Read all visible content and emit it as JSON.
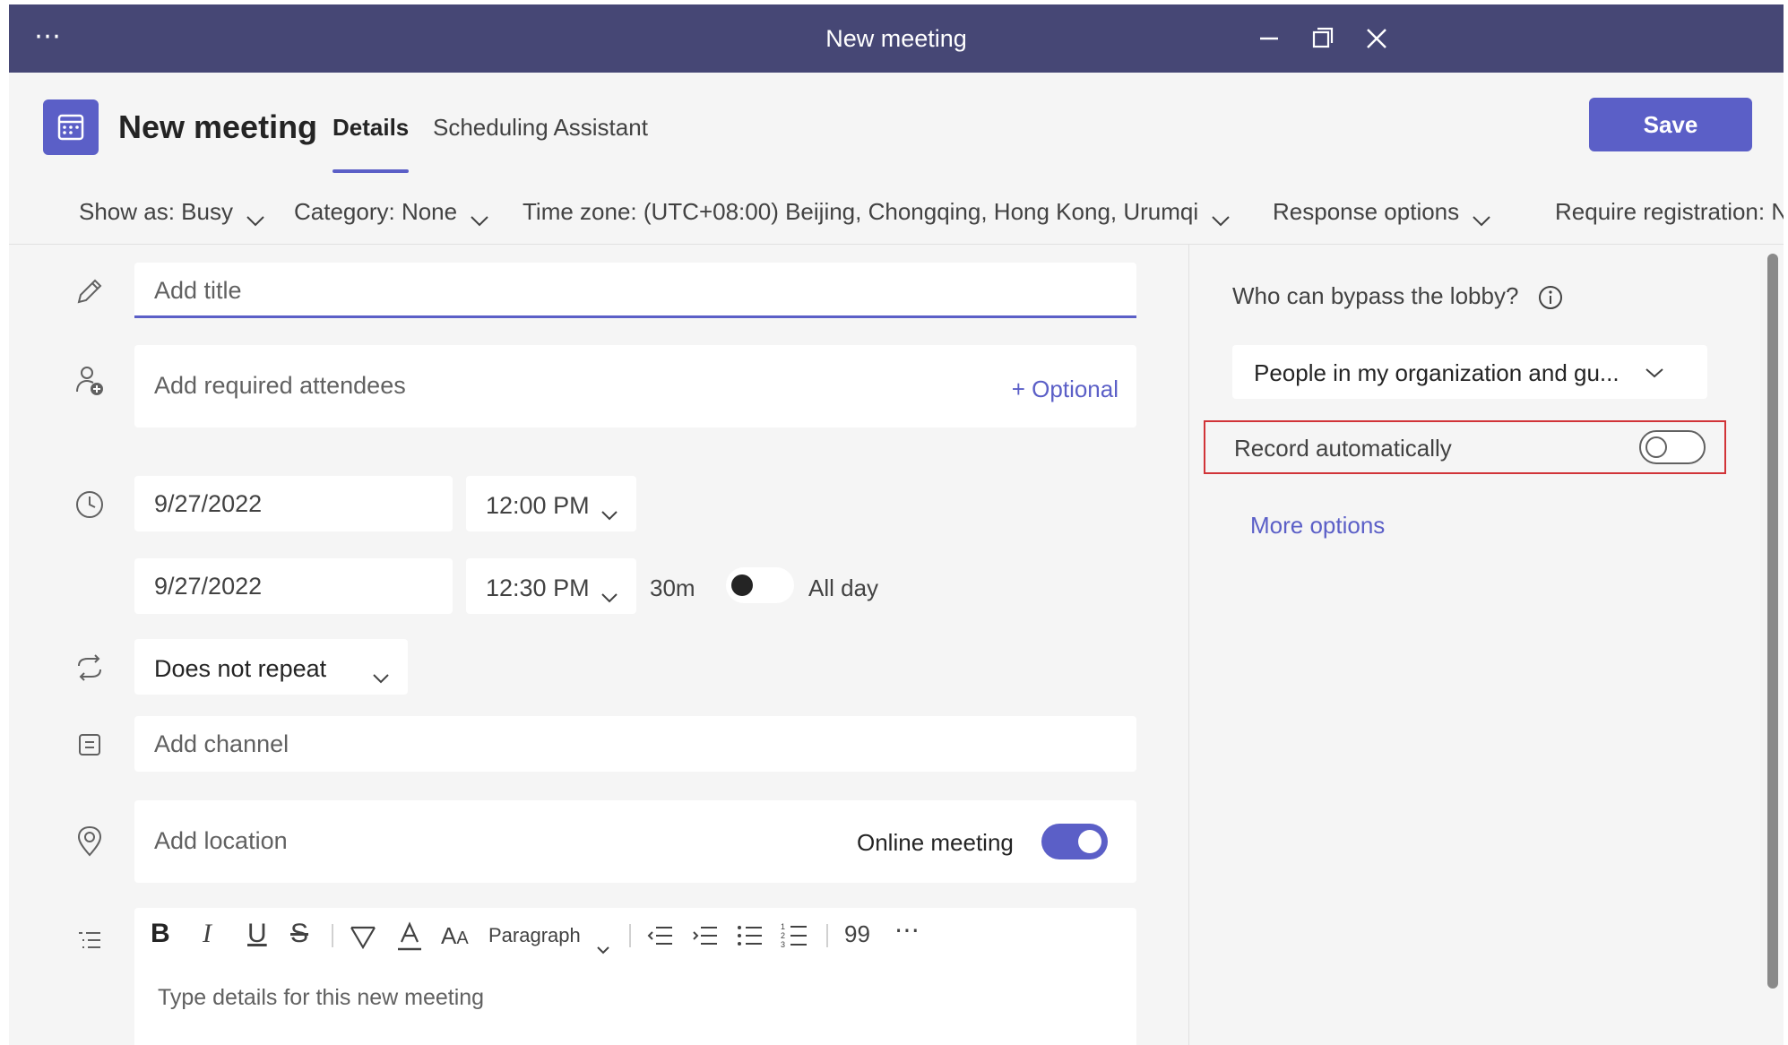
{
  "window": {
    "title": "New meeting",
    "more_label": "⋯"
  },
  "header": {
    "title": "New meeting",
    "tabs": [
      {
        "label": "Details",
        "active": true
      },
      {
        "label": "Scheduling Assistant",
        "active": false
      }
    ],
    "save_label": "Save"
  },
  "options": {
    "show_as": "Show as: Busy",
    "category": "Category: None",
    "time_zone": "Time zone: (UTC+08:00) Beijing, Chongqing, Hong Kong, Urumqi",
    "response": "Response options",
    "registration": "Require registration: N"
  },
  "form": {
    "title_placeholder": "Add title",
    "attendees_placeholder": "Add required attendees",
    "optional_label": "+ Optional",
    "start_date": "9/27/2022",
    "start_time": "12:00 PM",
    "end_date": "9/27/2022",
    "end_time": "12:30 PM",
    "duration": "30m",
    "all_day_label": "All day",
    "all_day_on": false,
    "repeat": "Does not repeat",
    "channel_placeholder": "Add channel",
    "location_placeholder": "Add location",
    "online_meeting_label": "Online meeting",
    "online_meeting_on": true,
    "details_placeholder": "Type details for this new meeting"
  },
  "toolbar": {
    "bold": "B",
    "italic": "I",
    "underline": "U",
    "strike": "S",
    "paragraph": "Paragraph",
    "quote": "99",
    "more": "⋯"
  },
  "right_panel": {
    "lobby_label": "Who can bypass the lobby?",
    "lobby_value": "People in my organization and gu...",
    "record_label": "Record automatically",
    "record_on": false,
    "more_options": "More options"
  },
  "colors": {
    "titlebar": "#464775",
    "accent": "#5b5fc7",
    "highlight_box": "#d13438"
  }
}
